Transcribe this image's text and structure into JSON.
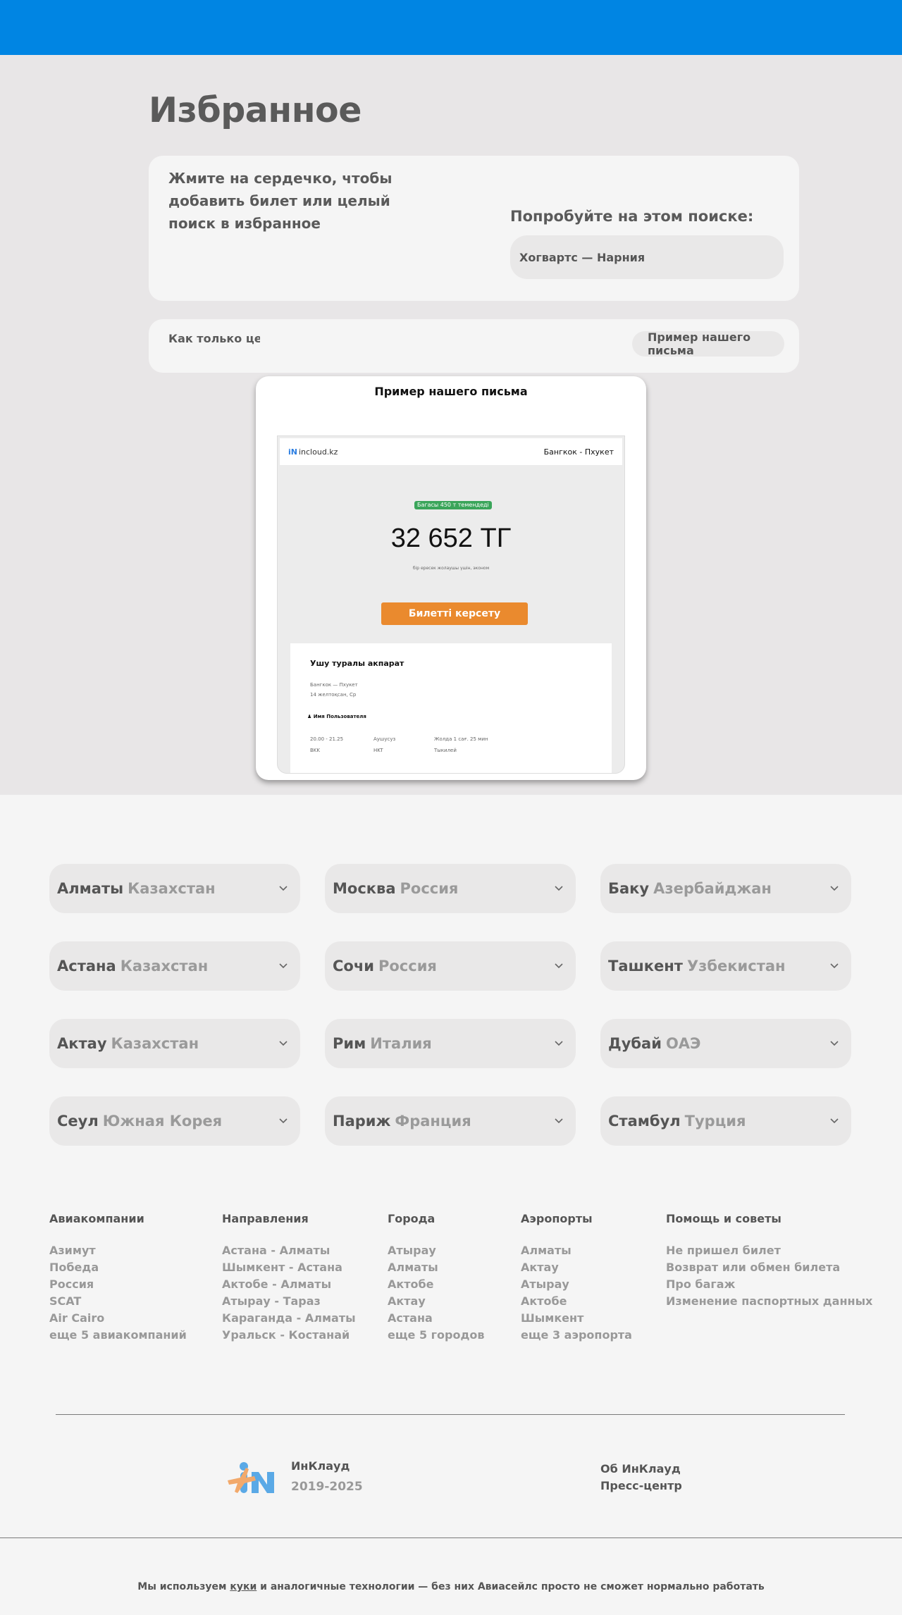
{
  "colors": {
    "topbar": "#0085e3",
    "accent_button": "#ea8a2e",
    "badge": "#3aa55a"
  },
  "favorites": {
    "title": "Избранное",
    "hint": "Жмите на сердечко, чтобы добавить билет или целый поиск в избранное",
    "try_label": "Попробуйте на этом поиске:",
    "try_search": "Хогвартс — Нарния"
  },
  "notify": {
    "text": "Как только цена изменится, мы отправим уведомление",
    "example_link": "Пример нашего письма"
  },
  "email_popup": {
    "title": "Пример нашего письма",
    "logo_text": "incloud.kz",
    "route": "Бангкок - Пхукет",
    "baggage_badge": "Багасы 450 т темендеді",
    "price": "32 652 ТГ",
    "price_note": "бір ересек жолаушы үшін, эконом",
    "buy_button": "Билетті керсету",
    "trip_title": "Ушу туралы акпарат",
    "trip_route": "Бангкок — Пхукет",
    "trip_date": "14 желтоқсан, Ср",
    "user": "Имя Пользователя",
    "time": "20.00 - 21.25",
    "from_code": "BKK",
    "carrier": "Аушусуз",
    "to_code": "HKT",
    "duration": "Жолда 1 сағ. 25 мин",
    "transfer": "Тыкилей"
  },
  "cities": [
    {
      "city": "Алматы",
      "country": "Казахстан"
    },
    {
      "city": "Москва",
      "country": "Россия"
    },
    {
      "city": "Баку",
      "country": "Азербайджан"
    },
    {
      "city": "Астана",
      "country": "Казахстан"
    },
    {
      "city": "Сочи",
      "country": "Россия"
    },
    {
      "city": "Ташкент",
      "country": "Узбекистан"
    },
    {
      "city": "Актау",
      "country": "Казахстан"
    },
    {
      "city": "Рим",
      "country": "Италия"
    },
    {
      "city": "Дубай",
      "country": "ОАЭ"
    },
    {
      "city": "Сеул",
      "country": "Южная Корея"
    },
    {
      "city": "Париж",
      "country": "Франция"
    },
    {
      "city": "Стамбул",
      "country": "Турция"
    }
  ],
  "footer_links": [
    {
      "heading": "Авиакомпании",
      "items": [
        "Азимут",
        "Победа",
        "Россия",
        "SCAT",
        "Air Cairo",
        "еще 5 авиакомпаний"
      ]
    },
    {
      "heading": "Направления",
      "items": [
        "Астана - Алматы",
        "Шымкент - Астана",
        "Актобе - Алматы",
        "Атырау - Тараз",
        "Караганда - Алматы",
        "Уральск - Костанай"
      ]
    },
    {
      "heading": "Города",
      "items": [
        "Атырау",
        "Алматы",
        "Актобе",
        "Актау",
        "Астана",
        "еще 5 городов"
      ]
    },
    {
      "heading": "Аэропорты",
      "items": [
        "Алматы",
        "Актау",
        "Атырау",
        "Актобе",
        "Шымкент",
        "еще 3 аэропорта"
      ]
    },
    {
      "heading": "Помощь и советы",
      "items": [
        "Не пришел билет",
        "Возврат или обмен билета",
        "Про багаж",
        "Изменение паспортных данных"
      ]
    }
  ],
  "brand": {
    "name": "ИнКлауд",
    "years": "2019-2025"
  },
  "about_links": [
    "Об ИнКлауд",
    "Пресс-центр"
  ],
  "cookie": {
    "before": "Мы используем ",
    "link": "куки",
    "after": " и аналогичные технологии — без них Авиасейлс просто не сможет нормально работать"
  }
}
